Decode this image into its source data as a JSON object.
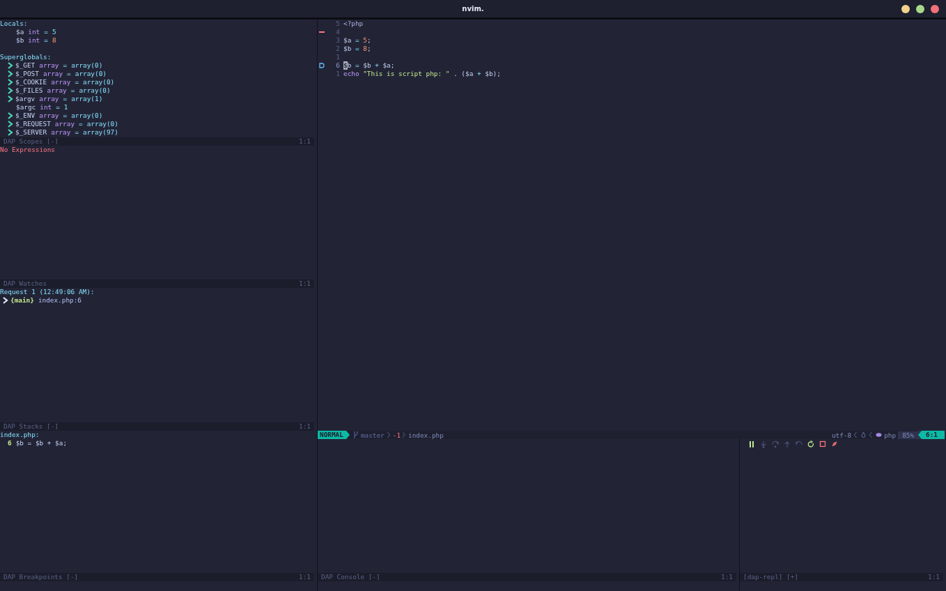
{
  "window": {
    "title": "nvim."
  },
  "scopes": {
    "sections": [
      {
        "title": "Locals:",
        "variables": [
          {
            "name": "$a",
            "type": "int",
            "assign": "=",
            "value": "5",
            "expandable": false,
            "changed": false
          },
          {
            "name": "$b",
            "type": "int",
            "assign": "=",
            "value": "8",
            "expandable": false,
            "changed": true
          }
        ]
      },
      {
        "title": "Superglobals:",
        "variables": [
          {
            "name": "$_GET",
            "type": "array",
            "assign": "=",
            "value": "array(0)",
            "expandable": true,
            "changed": false
          },
          {
            "name": "$_POST",
            "type": "array",
            "assign": "=",
            "value": "array(0)",
            "expandable": true,
            "changed": false
          },
          {
            "name": "$_COOKIE",
            "type": "array",
            "assign": "=",
            "value": "array(0)",
            "expandable": true,
            "changed": false
          },
          {
            "name": "$_FILES",
            "type": "array",
            "assign": "=",
            "value": "array(0)",
            "expandable": true,
            "changed": false
          },
          {
            "name": "$argv",
            "type": "array",
            "assign": "=",
            "value": "array(1)",
            "expandable": true,
            "changed": false
          },
          {
            "name": "$argc",
            "type": "int",
            "assign": "=",
            "value": "1",
            "expandable": false,
            "changed": false
          },
          {
            "name": "$_ENV",
            "type": "array",
            "assign": "=",
            "value": "array(0)",
            "expandable": true,
            "changed": false
          },
          {
            "name": "$_REQUEST",
            "type": "array",
            "assign": "=",
            "value": "array(0)",
            "expandable": true,
            "changed": false
          },
          {
            "name": "$_SERVER",
            "type": "array",
            "assign": "=",
            "value": "array(97)",
            "expandable": true,
            "changed": false
          }
        ]
      }
    ],
    "status": {
      "name": "DAP Scopes [-]",
      "position": "1:1"
    }
  },
  "watches": {
    "message": "No Expressions",
    "status": {
      "name": "DAP Watches",
      "position": "1:1"
    }
  },
  "stacks": {
    "thread": "Request 1 (12:49:06 AM):",
    "frames": [
      {
        "name": "{main}",
        "location": "index.php:6"
      }
    ],
    "status": {
      "name": "DAP Stacks [-]",
      "position": "1:1"
    }
  },
  "breakpoints": {
    "file": "index.php:",
    "entries": [
      {
        "line": "6",
        "code": "$b = $b + $a;"
      }
    ],
    "status": {
      "name": "DAP Breakpoints [-]",
      "position": "1:1"
    }
  },
  "editor": {
    "lines": [
      {
        "number": "5",
        "current": false,
        "breakpoint_rejected": false,
        "stopped": false,
        "tokens": [
          {
            "kind": "tag",
            "text": "<?php"
          }
        ]
      },
      {
        "number": "4",
        "current": false,
        "breakpoint_rejected": true,
        "stopped": false
      },
      {
        "number": "3",
        "current": false,
        "breakpoint_rejected": false,
        "stopped": false,
        "tokens": [
          {
            "kind": "var",
            "text": "$a"
          },
          {
            "kind": "op",
            "text": " = "
          },
          {
            "kind": "num",
            "text": "5"
          },
          {
            "kind": "punct",
            "text": ";"
          }
        ]
      },
      {
        "number": "2",
        "current": false,
        "breakpoint_rejected": false,
        "stopped": false,
        "tokens": [
          {
            "kind": "var",
            "text": "$b"
          },
          {
            "kind": "op",
            "text": " = "
          },
          {
            "kind": "num",
            "text": "8"
          },
          {
            "kind": "punct",
            "text": ";"
          }
        ]
      },
      {
        "number": "1",
        "current": false,
        "breakpoint_rejected": false,
        "stopped": false
      },
      {
        "number": "6",
        "current": true,
        "breakpoint_rejected": false,
        "stopped": true,
        "tokens": [
          {
            "kind": "var",
            "text": "$b"
          },
          {
            "kind": "op",
            "text": " = "
          },
          {
            "kind": "var",
            "text": "$b"
          },
          {
            "kind": "op",
            "text": " + "
          },
          {
            "kind": "var",
            "text": "$a"
          },
          {
            "kind": "punct",
            "text": ";"
          }
        ]
      },
      {
        "number": "1",
        "current": false,
        "breakpoint_rejected": false,
        "stopped": false,
        "tokens": [
          {
            "kind": "keyword",
            "text": "echo"
          },
          {
            "kind": "string",
            "text": "\"This is script php: \""
          },
          {
            "kind": "op",
            "text": " . "
          },
          {
            "kind": "punct",
            "text": "("
          },
          {
            "kind": "var",
            "text": "$a"
          },
          {
            "kind": "op",
            "text": " + "
          },
          {
            "kind": "var",
            "text": "$b"
          },
          {
            "kind": "punct",
            "text": ");"
          }
        ]
      }
    ]
  },
  "statusline": {
    "mode": "NORMAL",
    "branch": "master",
    "diff": "-1",
    "file": "index.php",
    "encoding": "utf-8",
    "filetype": "php",
    "percent": "85%",
    "position": "6:1"
  },
  "console": {
    "status": {
      "name": "DAP Console [-]",
      "position": "1:1"
    }
  },
  "repl": {
    "controls": [
      {
        "kind": "pause",
        "disabled": false
      },
      {
        "kind": "step_into",
        "disabled": true
      },
      {
        "kind": "step_over",
        "disabled": true
      },
      {
        "kind": "step_out",
        "disabled": true
      },
      {
        "kind": "step_back",
        "disabled": true
      },
      {
        "kind": "restart",
        "disabled": false
      },
      {
        "kind": "stop",
        "disabled": false
      },
      {
        "kind": "disconnect",
        "disabled": false
      }
    ],
    "status": {
      "name": "[dap-repl] [+]",
      "position": "1:1"
    }
  }
}
